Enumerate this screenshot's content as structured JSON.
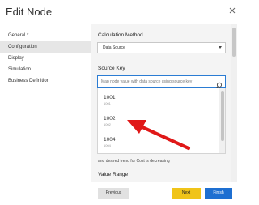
{
  "dialog": {
    "title": "Edit Node"
  },
  "sidebar": {
    "items": [
      {
        "label": "General *",
        "active": false
      },
      {
        "label": "Configuration",
        "active": true
      },
      {
        "label": "Display",
        "active": false
      },
      {
        "label": "Simulation",
        "active": false
      },
      {
        "label": "Business Definition",
        "active": false
      }
    ]
  },
  "main": {
    "calculation_method_label": "Calculation Method",
    "calculation_method_value": "Data Source",
    "source_key_label": "Source Key",
    "source_key_placeholder": "Map node value with data source using source key",
    "dropdown_items": [
      {
        "main": "1001",
        "sub": "1001"
      },
      {
        "main": "1002",
        "sub": "1002"
      },
      {
        "main": "1004",
        "sub": "1004"
      }
    ],
    "trend_text": "and desired trend for Cost is decreasing",
    "value_range_label": "Value Range"
  },
  "footer": {
    "previous_label": "Previous",
    "next_label": "Next",
    "finish_label": "Finish"
  },
  "colors": {
    "next": "#f0c419",
    "finish": "#1e6fd1",
    "arrow": "#e01818",
    "focus": "#2b7cd3"
  },
  "icons": {
    "close": "close-icon",
    "search": "search-icon",
    "caret": "chevron-down-icon"
  }
}
